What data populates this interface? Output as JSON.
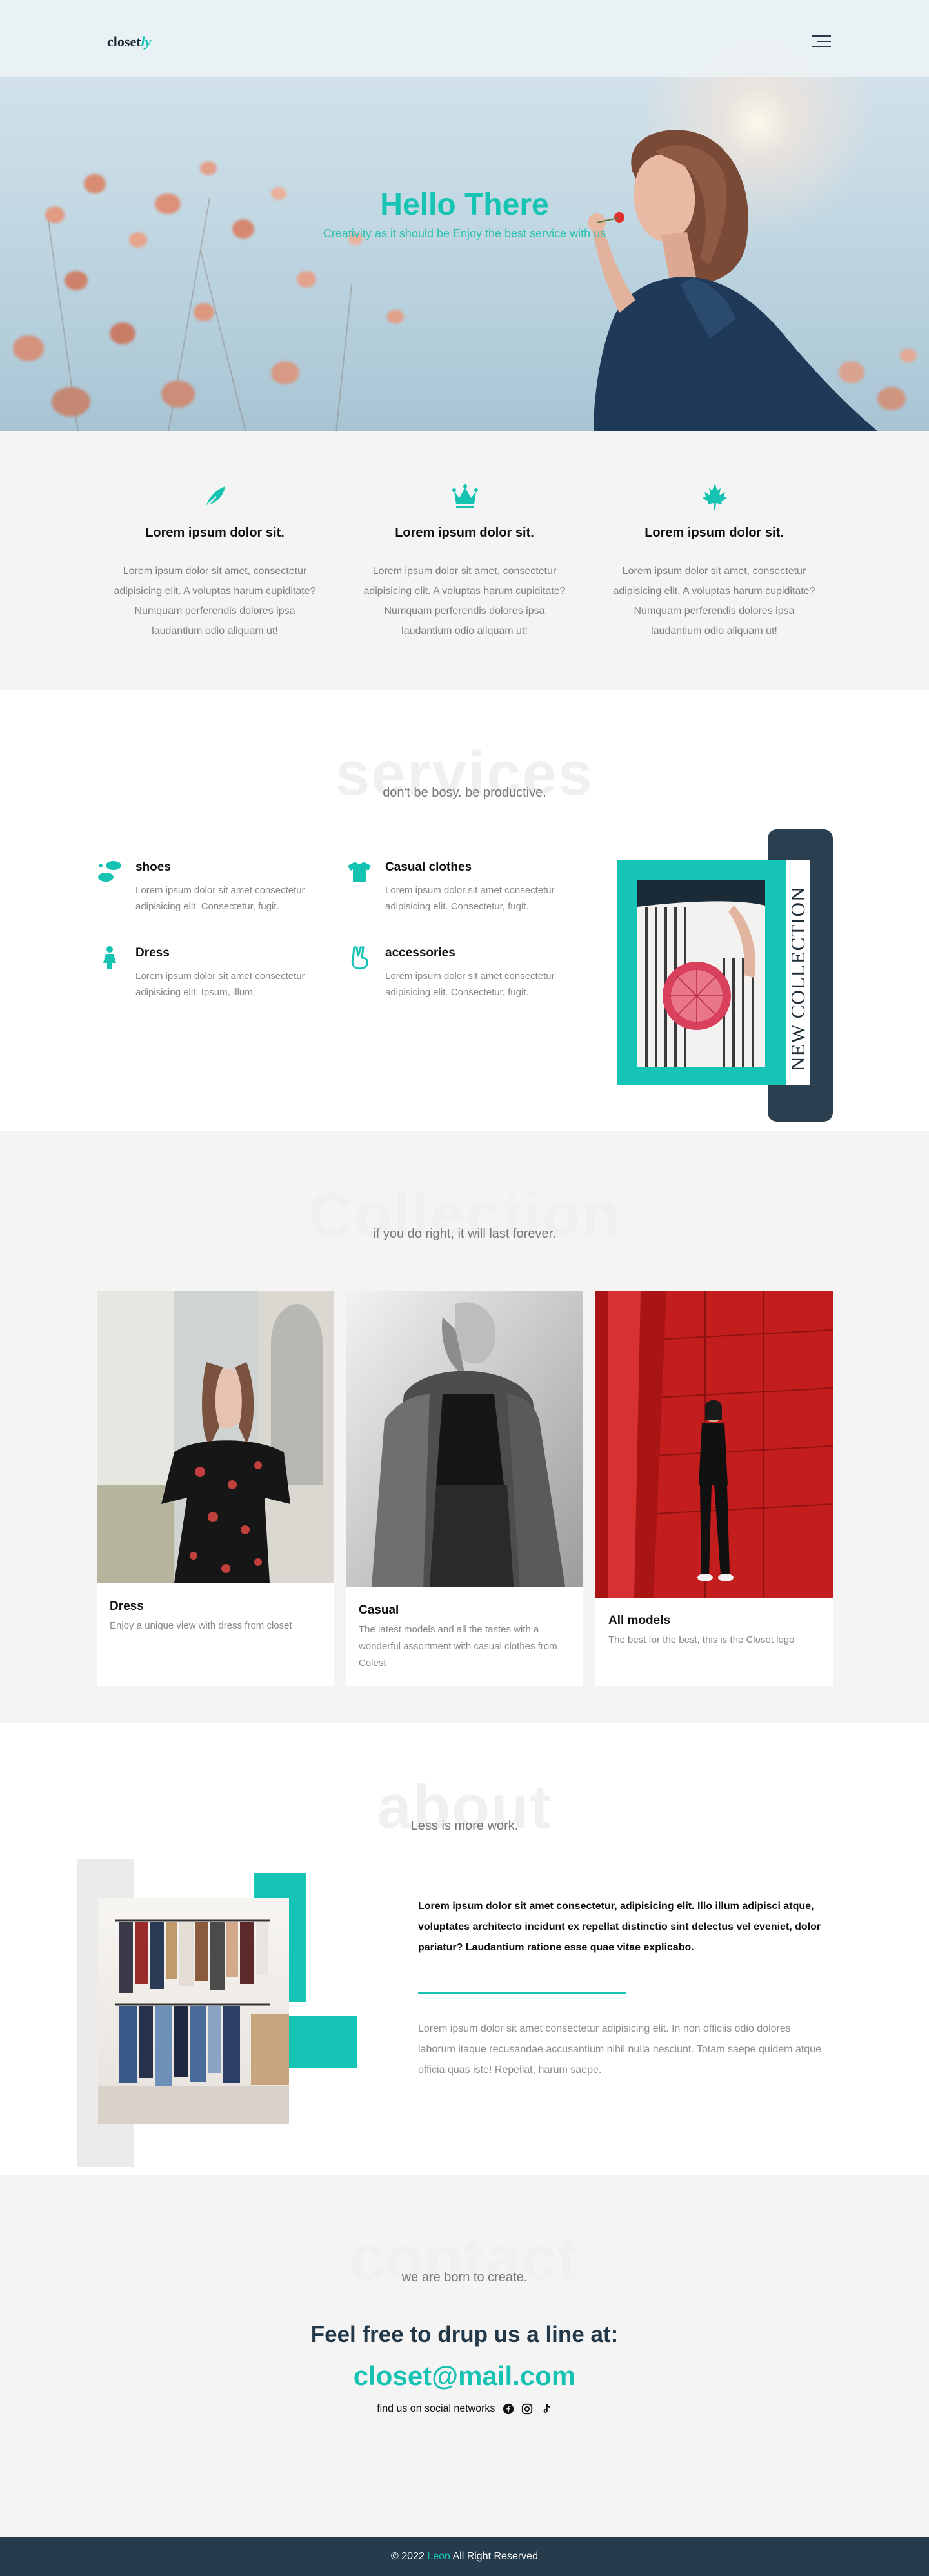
{
  "header": {
    "logo_text": "closet",
    "logo_accent": "ly"
  },
  "hero": {
    "title": "Hello There",
    "subtitle": "Creativity as it should be Enjoy the best service with us"
  },
  "features": [
    {
      "icon": "feather-icon",
      "title": "Lorem ipsum dolor sit.",
      "text": "Lorem ipsum dolor sit amet, consectetur adipisicing elit. A voluptas harum cupiditate? Numquam perferendis dolores ipsa laudantium odio aliquam ut!"
    },
    {
      "icon": "crown-icon",
      "title": "Lorem ipsum dolor sit.",
      "text": "Lorem ipsum dolor sit amet, consectetur adipisicing elit. A voluptas harum cupiditate? Numquam perferendis dolores ipsa laudantium odio aliquam ut!"
    },
    {
      "icon": "maple-leaf-icon",
      "title": "Lorem ipsum dolor sit.",
      "text": "Lorem ipsum dolor sit amet, consectetur adipisicing elit. A voluptas harum cupiditate? Numquam perferendis dolores ipsa laudantium odio aliquam ut!"
    }
  ],
  "services": {
    "title": "services",
    "subtitle": "don't be bosy. be productive.",
    "items": [
      {
        "icon": "shoes-icon",
        "title": "shoes",
        "text": "Lorem ipsum dolor sit amet consectetur adipisicing elit. Consectetur, fugit."
      },
      {
        "icon": "tshirt-icon",
        "title": "Casual clothes",
        "text": "Lorem ipsum dolor sit amet consectetur adipisicing elit. Consectetur, fugit."
      },
      {
        "icon": "person-dress-icon",
        "title": "Dress",
        "text": "Lorem ipsum dolor sit amet consectetur adipisicing elit. Ipsum, illum."
      },
      {
        "icon": "hand-peace-icon",
        "title": "accessories",
        "text": "Lorem ipsum dolor sit amet consectetur adipisicing elit. Consectetur, fugit."
      }
    ],
    "banner_text": "NEW COLLECTION"
  },
  "collection": {
    "title": "Collection",
    "subtitle": "if you do right, it will last forever.",
    "cards": [
      {
        "title": "Dress",
        "text": "Enjoy a unique view with dress from closet"
      },
      {
        "title": "Casual",
        "text": "The latest models and all the tastes with a wonderful assortment with casual clothes from Colest"
      },
      {
        "title": "All models",
        "text": "The best for the best, this is the Closet logo"
      }
    ]
  },
  "about": {
    "title": "about",
    "subtitle": "Less is more work.",
    "bold_text": "Lorem ipsum dolor sit amet consectetur, adipisicing elit. Illo illum adipisci atque, voluptates architecto incidunt ex repellat distinctio sint delectus vel eveniet, dolor pariatur? Laudantium ratione esse quae vitae explicabo.",
    "text": "Lorem ipsum dolor sit amet consectetur adipisicing elit. In non officiis odio dolores laborum itaque recusandae accusantium nihil nulla nesciunt. Totam saepe quidem atque officia quas iste! Repellat, harum saepe."
  },
  "contact": {
    "title": "contact",
    "subtitle": "we are born to create.",
    "heading": "Feel free to drup us a line at:",
    "email": "closet@mail.com",
    "social_label": "find us on social networks",
    "social": [
      "facebook-icon",
      "instagram-icon",
      "tiktok-icon"
    ]
  },
  "footer": {
    "prefix": "© 2022",
    "name": "Leon",
    "suffix": "All Right Reserved"
  },
  "colors": {
    "accent": "#16c3b2",
    "dark": "#263b4b",
    "light_bg": "#f4f4f4"
  }
}
